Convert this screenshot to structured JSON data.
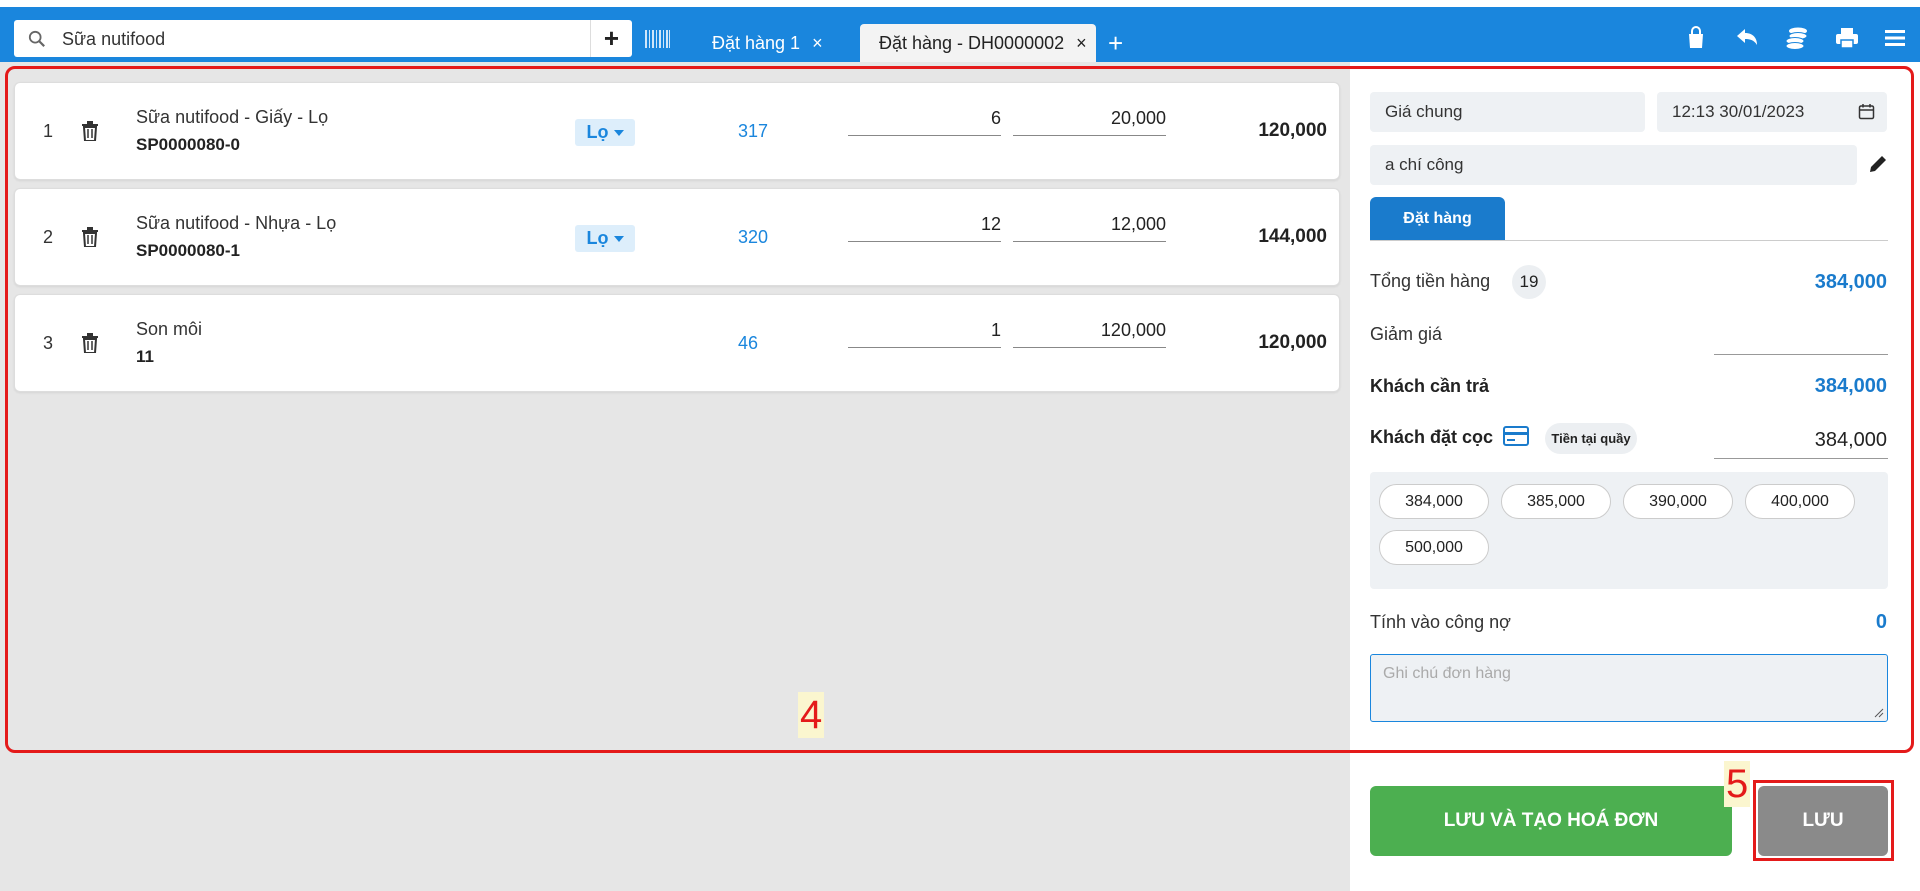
{
  "toolbar": {
    "search_value": "Sữa nutifood",
    "tabs": [
      {
        "label": "Đặt hàng 1",
        "close": "×"
      },
      {
        "label": "Đặt hàng - DH0000002",
        "close": "×"
      }
    ],
    "add_tab": "+",
    "add_product": "+",
    "icons": [
      "shopping-bag-icon",
      "undo-icon",
      "coins-icon",
      "print-icon",
      "menu-icon"
    ]
  },
  "items": [
    {
      "index": "1",
      "name": "Sữa nutifood - Giấy - Lọ",
      "code": "SP0000080-0",
      "unit": "Lọ",
      "stock": "317",
      "qty": "6",
      "price": "20,000",
      "total": "120,000"
    },
    {
      "index": "2",
      "name": "Sữa nutifood - Nhựa - Lọ",
      "code": "SP0000080-1",
      "unit": "Lọ",
      "stock": "320",
      "qty": "12",
      "price": "12,000",
      "total": "144,000"
    },
    {
      "index": "3",
      "name": "Son môi",
      "code": "11",
      "unit": "",
      "stock": "46",
      "qty": "1",
      "price": "120,000",
      "total": "120,000"
    }
  ],
  "order": {
    "price_book": "Giá chung",
    "datetime": "12:13 30/01/2023",
    "customer": "a chí công",
    "tab_label": "Đặt hàng",
    "subtotal_label": "Tổng tiền hàng",
    "item_count": "19",
    "subtotal": "384,000",
    "discount_label": "Giảm giá",
    "payable_label": "Khách cần trả",
    "payable": "384,000",
    "deposit_label": "Khách đặt cọc",
    "payment_method": "Tiền tại quầy",
    "deposit": "384,000",
    "quick_amounts": [
      "384,000",
      "385,000",
      "390,000",
      "400,000",
      "500,000"
    ],
    "debt_label": "Tính vào công nợ",
    "debt": "0",
    "note_placeholder": "Ghi chú đơn hàng",
    "btn_save_invoice": "LƯU VÀ TẠO HOÁ ĐƠN",
    "btn_save": "LƯU"
  },
  "annotations": {
    "label_4": "4",
    "label_5": "5"
  },
  "colors": {
    "primary": "#1a86dd",
    "success": "#4caf50",
    "annotation": "#e41a1a"
  }
}
